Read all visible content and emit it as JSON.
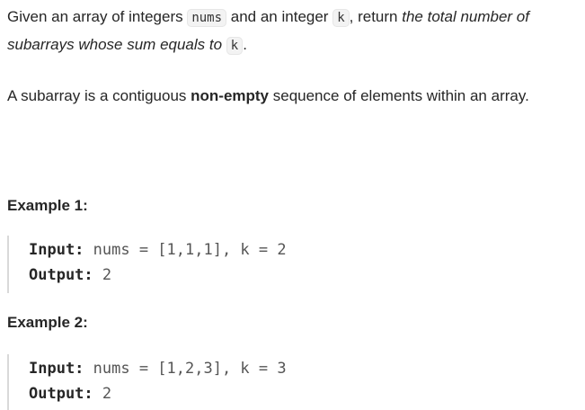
{
  "description": {
    "p1": {
      "part1": "Given an array of integers ",
      "code_nums": "nums",
      "part2": " and an integer ",
      "code_k": "k",
      "part3": ", return ",
      "italic": "the total number of subarrays whose sum equals to",
      "part4": " ",
      "code_k2": "k",
      "part5": "."
    },
    "p2": {
      "part1": "A subarray is a contiguous ",
      "bold": "non-empty",
      "part2": " sequence of elements within an array."
    }
  },
  "examples": [
    {
      "title": "Example 1:",
      "input_label": "Input:",
      "input_value": " nums = [1,1,1], k = 2",
      "output_label": "Output:",
      "output_value": " 2"
    },
    {
      "title": "Example 2:",
      "input_label": "Input:",
      "input_value": " nums = [1,2,3], k = 3",
      "output_label": "Output:",
      "output_value": " 2"
    }
  ]
}
